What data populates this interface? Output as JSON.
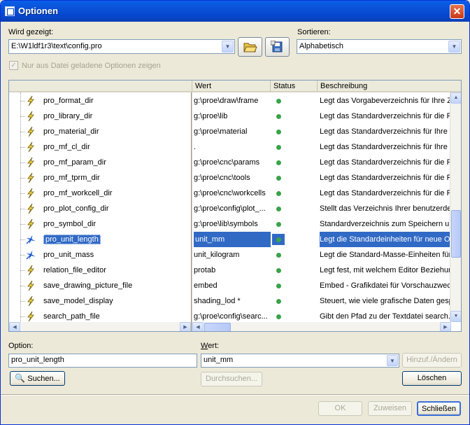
{
  "window": {
    "title": "Optionen",
    "close_label": "✕"
  },
  "shown": {
    "label": "Wird gezeigt:",
    "value": "E:\\W1ldf1r3\\text\\config.pro"
  },
  "sort": {
    "label": "Sortieren:",
    "value": "Alphabetisch"
  },
  "filter": {
    "label": "Nur aus Datei geladene Optionen zeigen",
    "checked": true,
    "check_glyph": "✓"
  },
  "columns": {
    "name": "",
    "wert": "Wert",
    "status": "Status",
    "desc": "Beschreibung"
  },
  "rows": [
    {
      "name": "pro_format_dir",
      "wert": "g:\\proe\\draw\\frame",
      "desc": "Legt das Vorgabeverzeichnis für Ihre Ze",
      "icon": "lightning-icon"
    },
    {
      "name": "pro_library_dir",
      "wert": "g:\\proe\\lib",
      "desc": "Legt das Standardverzeichnis für die Pro",
      "icon": "lightning-icon"
    },
    {
      "name": "pro_material_dir",
      "wert": "g:\\proe\\material",
      "desc": "Legt das Standardverzeichnis für Ihre T",
      "icon": "lightning-icon"
    },
    {
      "name": "pro_mf_cl_dir",
      "wert": ".",
      "desc": "Legt das Standardverzeichnis für Ihre Fe",
      "icon": "lightning-icon"
    },
    {
      "name": "pro_mf_param_dir",
      "wert": "g:\\proe\\cnc\\params",
      "desc": "Legt das Standardverzeichnis für die Fe",
      "icon": "lightning-icon"
    },
    {
      "name": "pro_mf_tprm_dir",
      "wert": "g:\\proe\\cnc\\tools",
      "desc": "Legt das Standardverzeichnis für die Fe",
      "icon": "lightning-icon"
    },
    {
      "name": "pro_mf_workcell_dir",
      "wert": "g:\\proe\\cnc\\workcells",
      "desc": "Legt das Standardverzeichnis für die Fe",
      "icon": "lightning-icon"
    },
    {
      "name": "pro_plot_config_dir",
      "wert": "g:\\proe\\config\\plot_...",
      "desc": "Stellt das Verzeichnis Ihrer benutzerdefi",
      "icon": "lightning-icon"
    },
    {
      "name": "pro_symbol_dir",
      "wert": "g:\\proe\\lib\\symbols",
      "desc": "Standardverzeichnis zum Speichern und",
      "icon": "lightning-icon"
    },
    {
      "name": "pro_unit_length",
      "wert": "unit_mm",
      "desc": "Legt die Standardeinheiten für neue Ob",
      "icon": "star-icon"
    },
    {
      "name": "pro_unit_mass",
      "wert": "unit_kilogram",
      "desc": "Legt die Standard-Masse-Einheiten für n",
      "icon": "star-icon"
    },
    {
      "name": "relation_file_editor",
      "wert": "protab",
      "desc": "Legt fest, mit welchem Editor Beziehung",
      "icon": "lightning-icon"
    },
    {
      "name": "save_drawing_picture_file",
      "wert": "embed",
      "desc": "Embed - Grafikdatei für Vorschauzweck",
      "icon": "lightning-icon"
    },
    {
      "name": "save_model_display",
      "wert": "shading_lod *",
      "desc": "Steuert, wie viele grafische Daten gesp",
      "icon": "lightning-icon"
    },
    {
      "name": "search_path_file",
      "wert": "g:\\proe\\config\\searc...",
      "desc": "Gibt den Pfad zu der Textdatei search.p",
      "icon": "lightning-icon"
    }
  ],
  "selected_index": 9,
  "status_color": "#3aa34a",
  "option": {
    "label": "Option:",
    "value": "pro_unit_length"
  },
  "wert": {
    "label": "Wert:",
    "value": "unit_mm"
  },
  "buttons": {
    "search": "Suchen...",
    "browse": "Durchsuchen...",
    "add_change": "Hinzuf./Ändern",
    "delete": "Löschen",
    "ok": "OK",
    "apply": "Zuweisen",
    "close": "Schließen"
  }
}
